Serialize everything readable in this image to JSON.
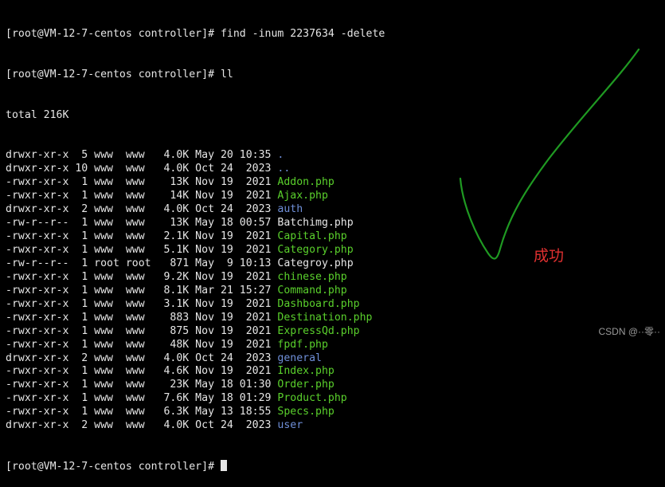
{
  "colors": {
    "background": "#000000",
    "text": "#e6e6e6",
    "directory": "#6f8fd8",
    "executable": "#5ad02c",
    "annotation_stroke": "#1f9a22",
    "annotation_text": "#e03030"
  },
  "terminal": {
    "prompt_lines": [
      "[root@VM-12-7-centos controller]# find -inum 2237634 -delete",
      "[root@VM-12-7-centos controller]# ll"
    ],
    "total": "total 216K",
    "entries": [
      {
        "perms": "drwxr-xr-x",
        "links": "5",
        "owner": "www",
        "group": "www",
        "size": "4.0K",
        "date": "May 20 10:35",
        "name": ".",
        "kind": "dir"
      },
      {
        "perms": "drwxr-xr-x",
        "links": "10",
        "owner": "www",
        "group": "www",
        "size": "4.0K",
        "date": "Oct 24  2023",
        "name": "..",
        "kind": "dir"
      },
      {
        "perms": "-rwxr-xr-x",
        "links": "1",
        "owner": "www",
        "group": "www",
        "size": "13K",
        "date": "Nov 19  2021",
        "name": "Addon.php",
        "kind": "exe"
      },
      {
        "perms": "-rwxr-xr-x",
        "links": "1",
        "owner": "www",
        "group": "www",
        "size": "14K",
        "date": "Nov 19  2021",
        "name": "Ajax.php",
        "kind": "exe"
      },
      {
        "perms": "drwxr-xr-x",
        "links": "2",
        "owner": "www",
        "group": "www",
        "size": "4.0K",
        "date": "Oct 24  2023",
        "name": "auth",
        "kind": "dir"
      },
      {
        "perms": "-rw-r--r--",
        "links": "1",
        "owner": "www",
        "group": "www",
        "size": "13K",
        "date": "May 18 00:57",
        "name": "Batchimg.php",
        "kind": "file"
      },
      {
        "perms": "-rwxr-xr-x",
        "links": "1",
        "owner": "www",
        "group": "www",
        "size": "2.1K",
        "date": "Nov 19  2021",
        "name": "Capital.php",
        "kind": "exe"
      },
      {
        "perms": "-rwxr-xr-x",
        "links": "1",
        "owner": "www",
        "group": "www",
        "size": "5.1K",
        "date": "Nov 19  2021",
        "name": "Category.php",
        "kind": "exe"
      },
      {
        "perms": "-rw-r--r--",
        "links": "1",
        "owner": "root",
        "group": "root",
        "size": "871",
        "date": "May  9 10:13",
        "name": "Categroy.php",
        "kind": "file"
      },
      {
        "perms": "-rwxr-xr-x",
        "links": "1",
        "owner": "www",
        "group": "www",
        "size": "9.2K",
        "date": "Nov 19  2021",
        "name": "chinese.php",
        "kind": "exe"
      },
      {
        "perms": "-rwxr-xr-x",
        "links": "1",
        "owner": "www",
        "group": "www",
        "size": "8.1K",
        "date": "Mar 21 15:27",
        "name": "Command.php",
        "kind": "exe"
      },
      {
        "perms": "-rwxr-xr-x",
        "links": "1",
        "owner": "www",
        "group": "www",
        "size": "3.1K",
        "date": "Nov 19  2021",
        "name": "Dashboard.php",
        "kind": "exe"
      },
      {
        "perms": "-rwxr-xr-x",
        "links": "1",
        "owner": "www",
        "group": "www",
        "size": "883",
        "date": "Nov 19  2021",
        "name": "Destination.php",
        "kind": "exe"
      },
      {
        "perms": "-rwxr-xr-x",
        "links": "1",
        "owner": "www",
        "group": "www",
        "size": "875",
        "date": "Nov 19  2021",
        "name": "ExpressQd.php",
        "kind": "exe"
      },
      {
        "perms": "-rwxr-xr-x",
        "links": "1",
        "owner": "www",
        "group": "www",
        "size": "48K",
        "date": "Nov 19  2021",
        "name": "fpdf.php",
        "kind": "exe"
      },
      {
        "perms": "drwxr-xr-x",
        "links": "2",
        "owner": "www",
        "group": "www",
        "size": "4.0K",
        "date": "Oct 24  2023",
        "name": "general",
        "kind": "dir"
      },
      {
        "perms": "-rwxr-xr-x",
        "links": "1",
        "owner": "www",
        "group": "www",
        "size": "4.6K",
        "date": "Nov 19  2021",
        "name": "Index.php",
        "kind": "exe"
      },
      {
        "perms": "-rwxr-xr-x",
        "links": "1",
        "owner": "www",
        "group": "www",
        "size": "23K",
        "date": "May 18 01:30",
        "name": "Order.php",
        "kind": "exe"
      },
      {
        "perms": "-rwxr-xr-x",
        "links": "1",
        "owner": "www",
        "group": "www",
        "size": "7.6K",
        "date": "May 18 01:29",
        "name": "Product.php",
        "kind": "exe"
      },
      {
        "perms": "-rwxr-xr-x",
        "links": "1",
        "owner": "www",
        "group": "www",
        "size": "6.3K",
        "date": "May 13 18:55",
        "name": "Specs.php",
        "kind": "exe"
      },
      {
        "perms": "drwxr-xr-x",
        "links": "2",
        "owner": "www",
        "group": "www",
        "size": "4.0K",
        "date": "Oct 24  2023",
        "name": "user",
        "kind": "dir"
      }
    ],
    "final_prompt": "[root@VM-12-7-centos controller]# "
  },
  "annotation": {
    "shape": "checkmark",
    "label": "成功"
  },
  "watermark": "CSDN @··零··"
}
